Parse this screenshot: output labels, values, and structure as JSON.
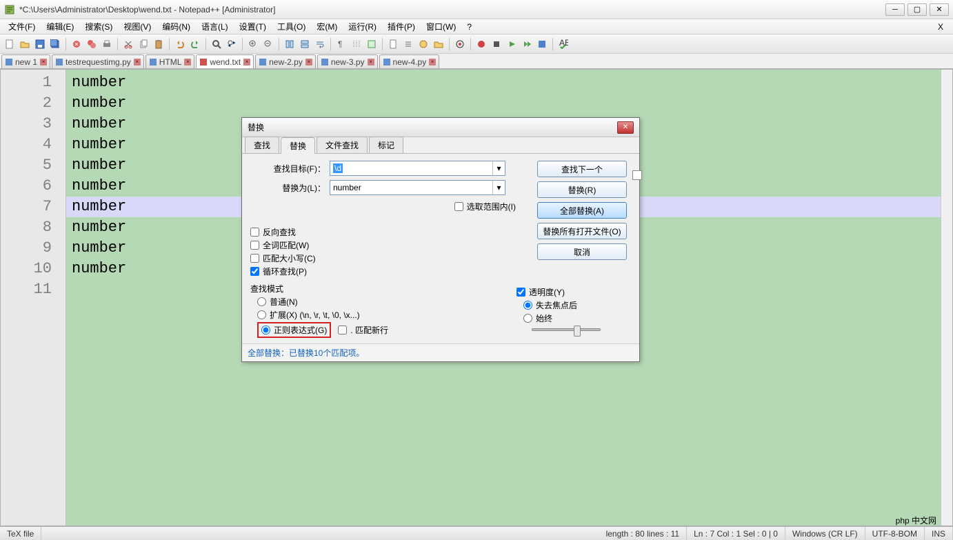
{
  "window": {
    "title": "*C:\\Users\\Administrator\\Desktop\\wend.txt - Notepad++ [Administrator]"
  },
  "menu": {
    "items": [
      "文件(F)",
      "编辑(E)",
      "搜索(S)",
      "视图(V)",
      "编码(N)",
      "语言(L)",
      "设置(T)",
      "工具(O)",
      "宏(M)",
      "运行(R)",
      "插件(P)",
      "窗口(W)",
      "?"
    ],
    "close_x": "X"
  },
  "tabs": [
    {
      "label": "new 1"
    },
    {
      "label": "testrequestimg.py"
    },
    {
      "label": "HTML"
    },
    {
      "label": "wend.txt",
      "active": true
    },
    {
      "label": "new-2.py"
    },
    {
      "label": "new-3.py"
    },
    {
      "label": "new-4.py"
    }
  ],
  "editor": {
    "lines": [
      "number",
      "number",
      "number",
      "number",
      "number",
      "number",
      "number",
      "number",
      "number",
      "number",
      ""
    ],
    "current_line_index": 6
  },
  "dialog": {
    "title": "替换",
    "tabs": [
      "查找",
      "替换",
      "文件查找",
      "标记"
    ],
    "active_tab_index": 1,
    "find_label": "查找目标(F)：",
    "find_value": "\\d",
    "replace_label": "替换为(L)：",
    "replace_value": "number",
    "in_selection": "选取范围内(I)",
    "buttons": {
      "find_next": "查找下一个",
      "replace": "替换(R)",
      "replace_all": "全部替换(A)",
      "replace_in_open": "替换所有打开文件(O)",
      "cancel": "取消"
    },
    "options": {
      "backward": "反向查找",
      "whole_word": "全词匹配(W)",
      "match_case": "匹配大小写(C)",
      "wrap": "循环查找(P)"
    },
    "search_mode_label": "查找模式",
    "modes": {
      "normal": "普通(N)",
      "extended": "扩展(X) (\\n, \\r, \\t, \\0, \\x...)",
      "regex": "正则表达式(G)",
      "match_newline": ". 匹配新行"
    },
    "transparency": {
      "label": "透明度(Y)",
      "on_lose_focus": "失去焦点后",
      "always": "始终"
    },
    "status": "全部替换：已替换10个匹配项。"
  },
  "statusbar": {
    "type": "TeX file",
    "length": "length : 80    lines : 11",
    "pos": "Ln : 7    Col : 1    Sel : 0 | 0",
    "eol": "Windows (CR LF)",
    "enc": "UTF-8-BOM",
    "mode": "INS"
  },
  "watermark": "php 中文网"
}
